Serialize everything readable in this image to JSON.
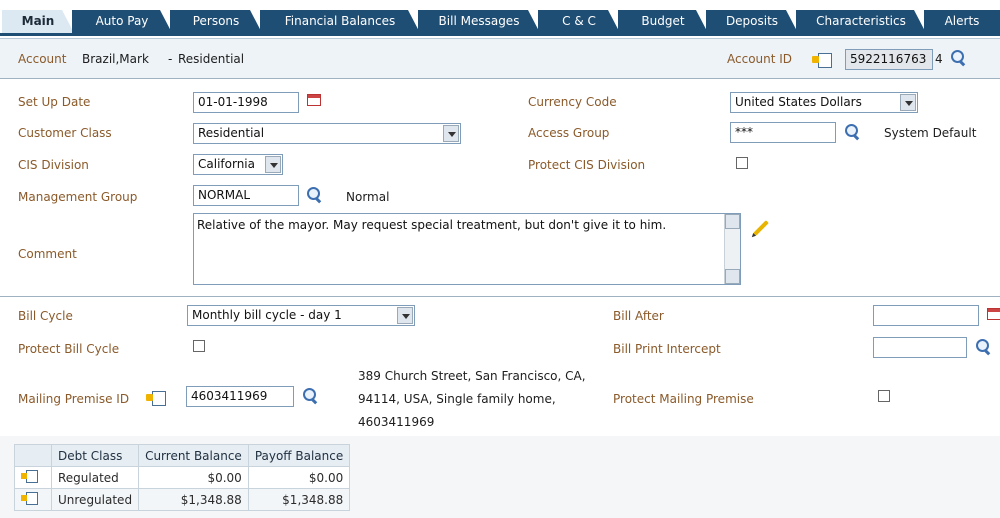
{
  "tabs": [
    "Main",
    "Auto Pay",
    "Persons",
    "Financial Balances",
    "Bill Messages",
    "C & C",
    "Budget",
    "Deposits",
    "Characteristics",
    "Alerts"
  ],
  "account": {
    "label": "Account",
    "name": "Brazil,Mark",
    "separator": "-",
    "type": "Residential",
    "id_label": "Account ID",
    "id_value": "5922116763",
    "check_digit": "4"
  },
  "fields": {
    "setup_date_label": "Set Up Date",
    "setup_date_value": "01-01-1998",
    "currency_code_label": "Currency Code",
    "currency_code_value": "United States Dollars",
    "customer_class_label": "Customer Class",
    "customer_class_value": "Residential",
    "access_group_label": "Access Group",
    "access_group_value": "***",
    "access_group_desc": "System Default",
    "cis_division_label": "CIS Division",
    "cis_division_value": "California",
    "protect_cis_label": "Protect CIS Division",
    "mgmt_group_label": "Management Group",
    "mgmt_group_value": "NORMAL",
    "mgmt_group_desc": "Normal",
    "comment_label": "Comment",
    "comment_value": "Relative of the mayor.  May request special treatment, but don't give it to him."
  },
  "billing": {
    "bill_cycle_label": "Bill Cycle",
    "bill_cycle_value": "Monthly bill cycle - day 1",
    "bill_after_label": "Bill After",
    "protect_bill_cycle_label": "Protect Bill Cycle",
    "bill_print_intercept_label": "Bill Print Intercept",
    "mailing_premise_label": "Mailing Premise ID",
    "mailing_premise_value": "4603411969",
    "premise_address_line1": "389 Church Street, San Francisco, CA,",
    "premise_address_line2": "94114, USA, Single family home,",
    "premise_address_line3": "4603411969",
    "protect_mailing_label": "Protect Mailing Premise"
  },
  "balances": {
    "headers": [
      "Debt Class",
      "Current Balance",
      "Payoff Balance"
    ],
    "rows": [
      {
        "debt_class": "Regulated",
        "current": "$0.00",
        "payoff": "$0.00"
      },
      {
        "debt_class": "Unregulated",
        "current": "$1,348.88",
        "payoff": "$1,348.88"
      }
    ]
  }
}
